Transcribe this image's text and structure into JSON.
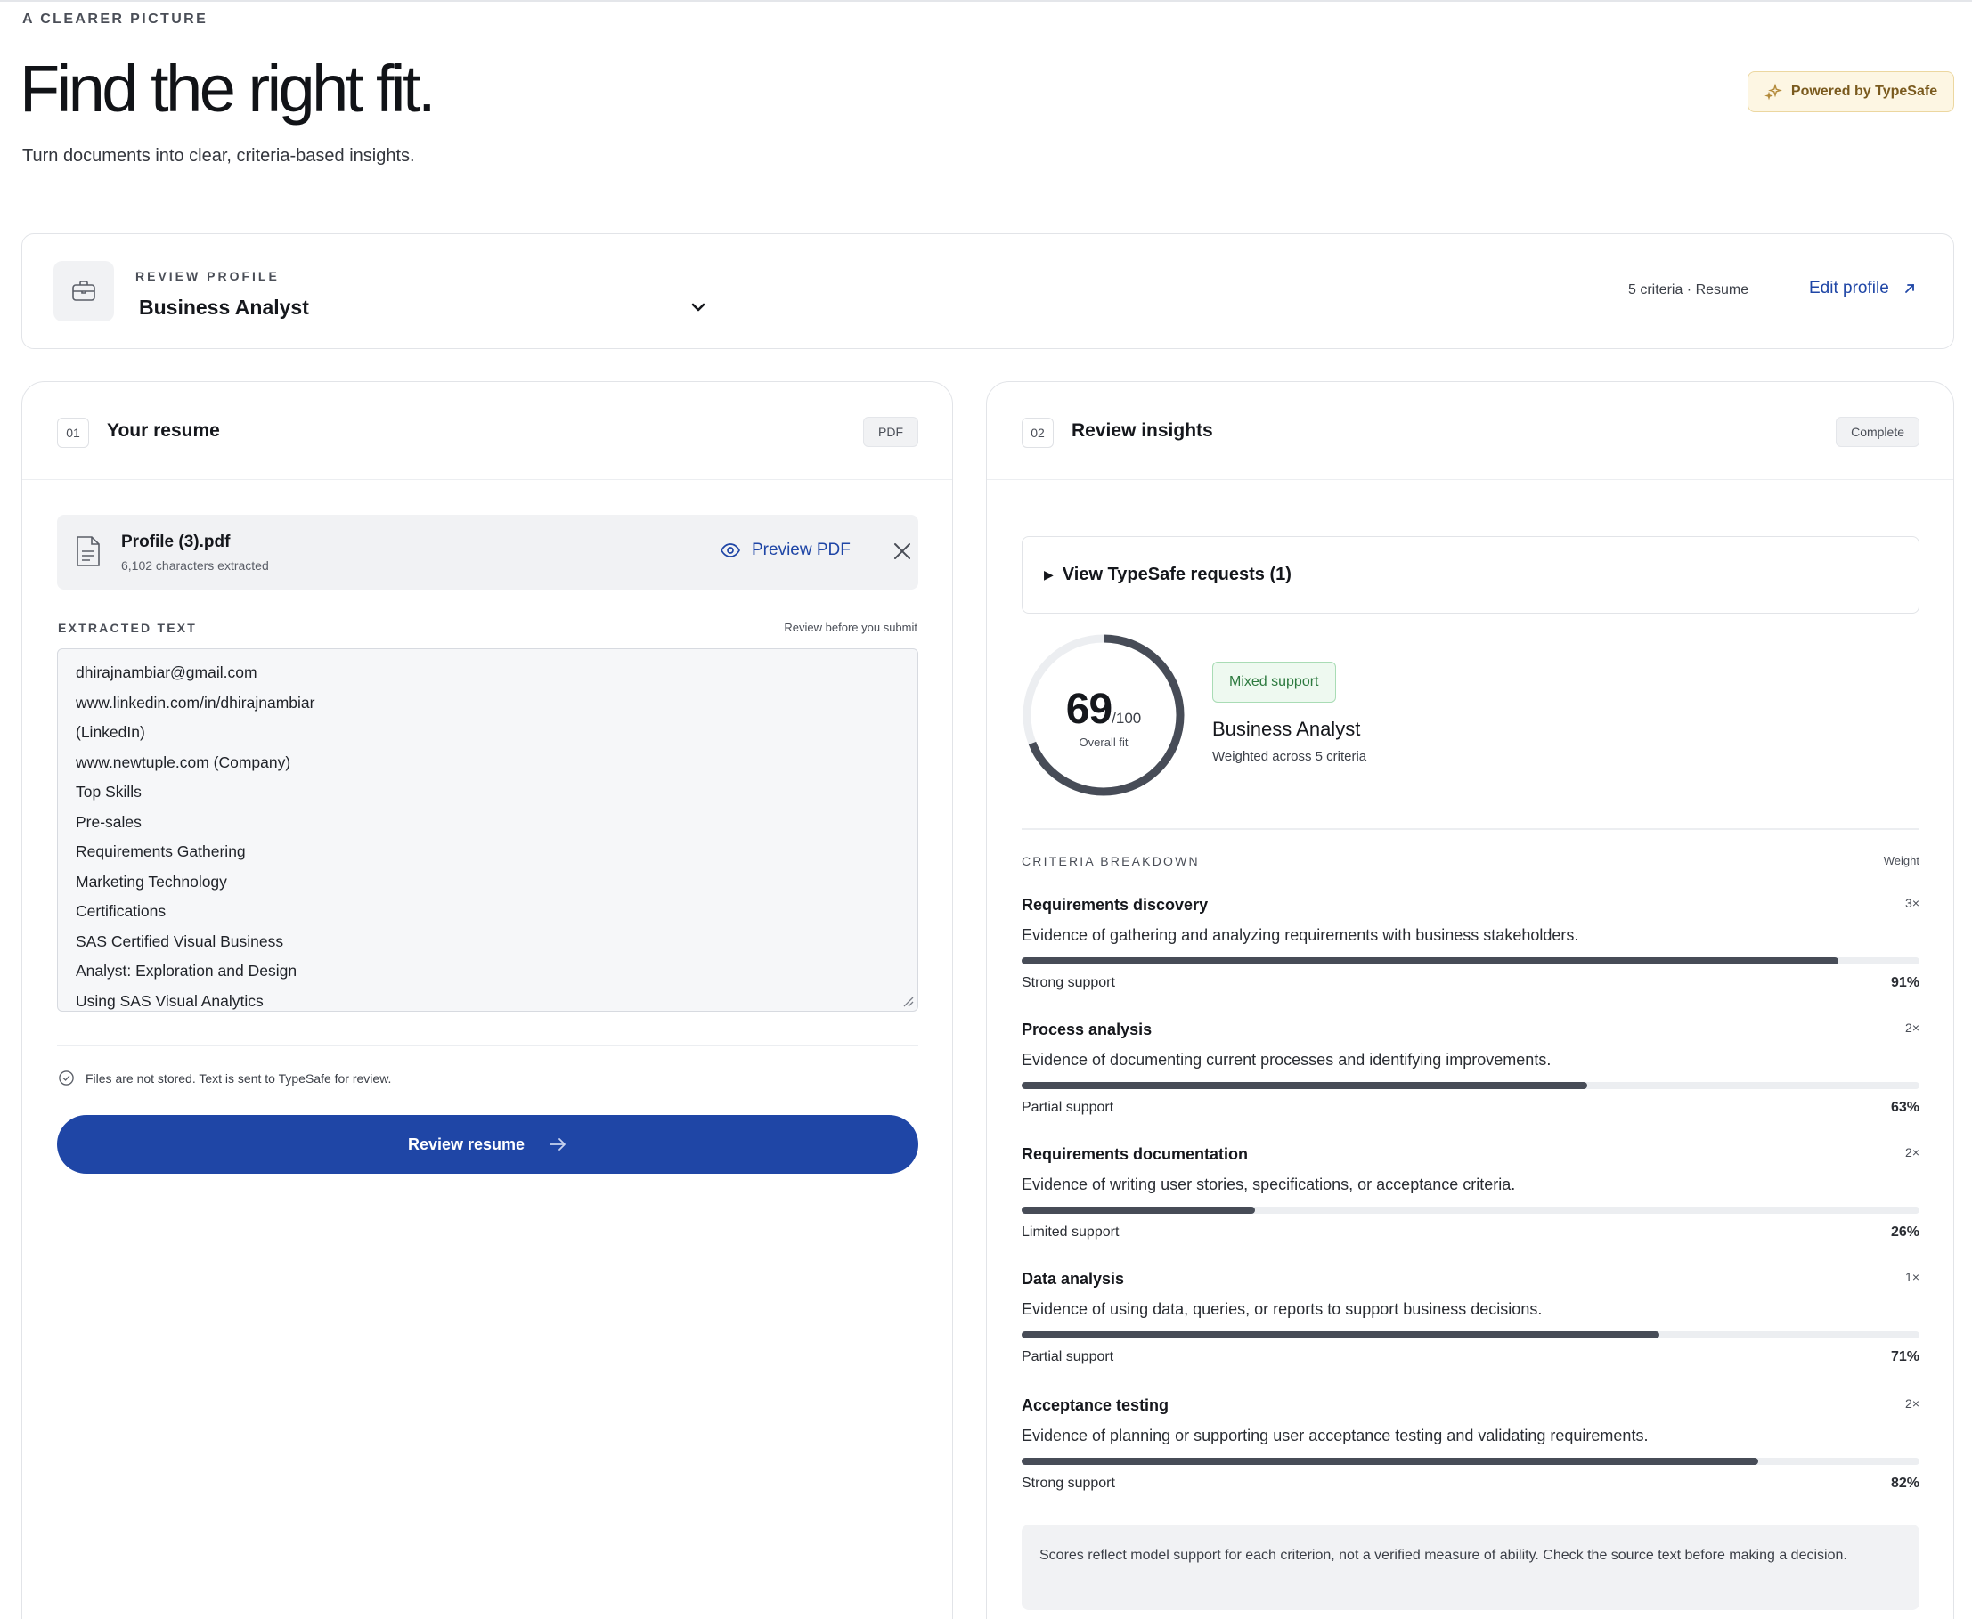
{
  "hero": {
    "eyebrow": "A CLEARER PICTURE",
    "title": "Find the right fit.",
    "subtitle": "Turn documents into clear, criteria-based insights.",
    "powered_by": "Powered by TypeSafe"
  },
  "profile": {
    "label": "REVIEW PROFILE",
    "selected": "Business Analyst",
    "meta": "5 criteria · Resume",
    "edit_label": "Edit profile"
  },
  "resume_panel": {
    "step": "01",
    "title": "Your resume",
    "badge": "PDF",
    "file": {
      "name": "Profile (3).pdf",
      "sub": "6,102 characters extracted",
      "preview_label": "Preview PDF"
    },
    "extracted_label": "EXTRACTED TEXT",
    "extracted_hint": "Review before you submit",
    "extracted_lines": [
      "dhirajnambiar@gmail.com",
      "www.linkedin.com/in/dhirajnambiar",
      "(LinkedIn)",
      "www.newtuple.com (Company)",
      "Top Skills",
      "Pre-sales",
      "Requirements Gathering",
      "Marketing Technology",
      "Certifications",
      "SAS Certified Visual Business",
      "Analyst: Exploration and Design",
      "Using SAS Visual Analytics"
    ],
    "notice": "Files are not stored. Text is sent to TypeSafe for review.",
    "submit_label": "Review resume"
  },
  "insights_panel": {
    "step": "02",
    "title": "Review insights",
    "badge": "Complete",
    "requests_label": "View TypeSafe requests (1)",
    "score": {
      "value": "69",
      "denominator": "/100",
      "caption": "Overall fit",
      "fraction": 0.69
    },
    "support_badge": "Mixed support",
    "role": "Business Analyst",
    "role_sub": "Weighted across 5 criteria",
    "breakdown_label": "CRITERIA BREAKDOWN",
    "weight_label": "Weight",
    "criteria": [
      {
        "name": "Requirements discovery",
        "weight": "3×",
        "description": "Evidence of gathering and analyzing requirements with business stakeholders.",
        "level": "Strong support",
        "percent": "91%",
        "value": 91
      },
      {
        "name": "Process analysis",
        "weight": "2×",
        "description": "Evidence of documenting current processes and identifying improvements.",
        "level": "Partial support",
        "percent": "63%",
        "value": 63
      },
      {
        "name": "Requirements documentation",
        "weight": "2×",
        "description": "Evidence of writing user stories, specifications, or acceptance criteria.",
        "level": "Limited support",
        "percent": "26%",
        "value": 26
      },
      {
        "name": "Data analysis",
        "weight": "1×",
        "description": "Evidence of using data, queries, or reports to support business decisions.",
        "level": "Partial support",
        "percent": "71%",
        "value": 71
      },
      {
        "name": "Acceptance testing",
        "weight": "2×",
        "description": "Evidence of planning or supporting user acceptance testing and validating requirements.",
        "level": "Strong support",
        "percent": "82%",
        "value": 82
      }
    ],
    "disclaimer": "Scores reflect model support for each criterion, not a verified measure of ability. Check the source text before making a decision."
  },
  "colors": {
    "accent": "#1f46a6",
    "bar": "#474c57",
    "powered_bg": "#fdf6e3",
    "support_green": "#2d7a3f"
  },
  "icons": [
    "briefcase-icon",
    "chevron-down-icon",
    "external-link-icon",
    "sparkle-icon",
    "document-icon",
    "eye-icon",
    "close-icon",
    "check-circle-icon",
    "arrow-right-icon"
  ]
}
